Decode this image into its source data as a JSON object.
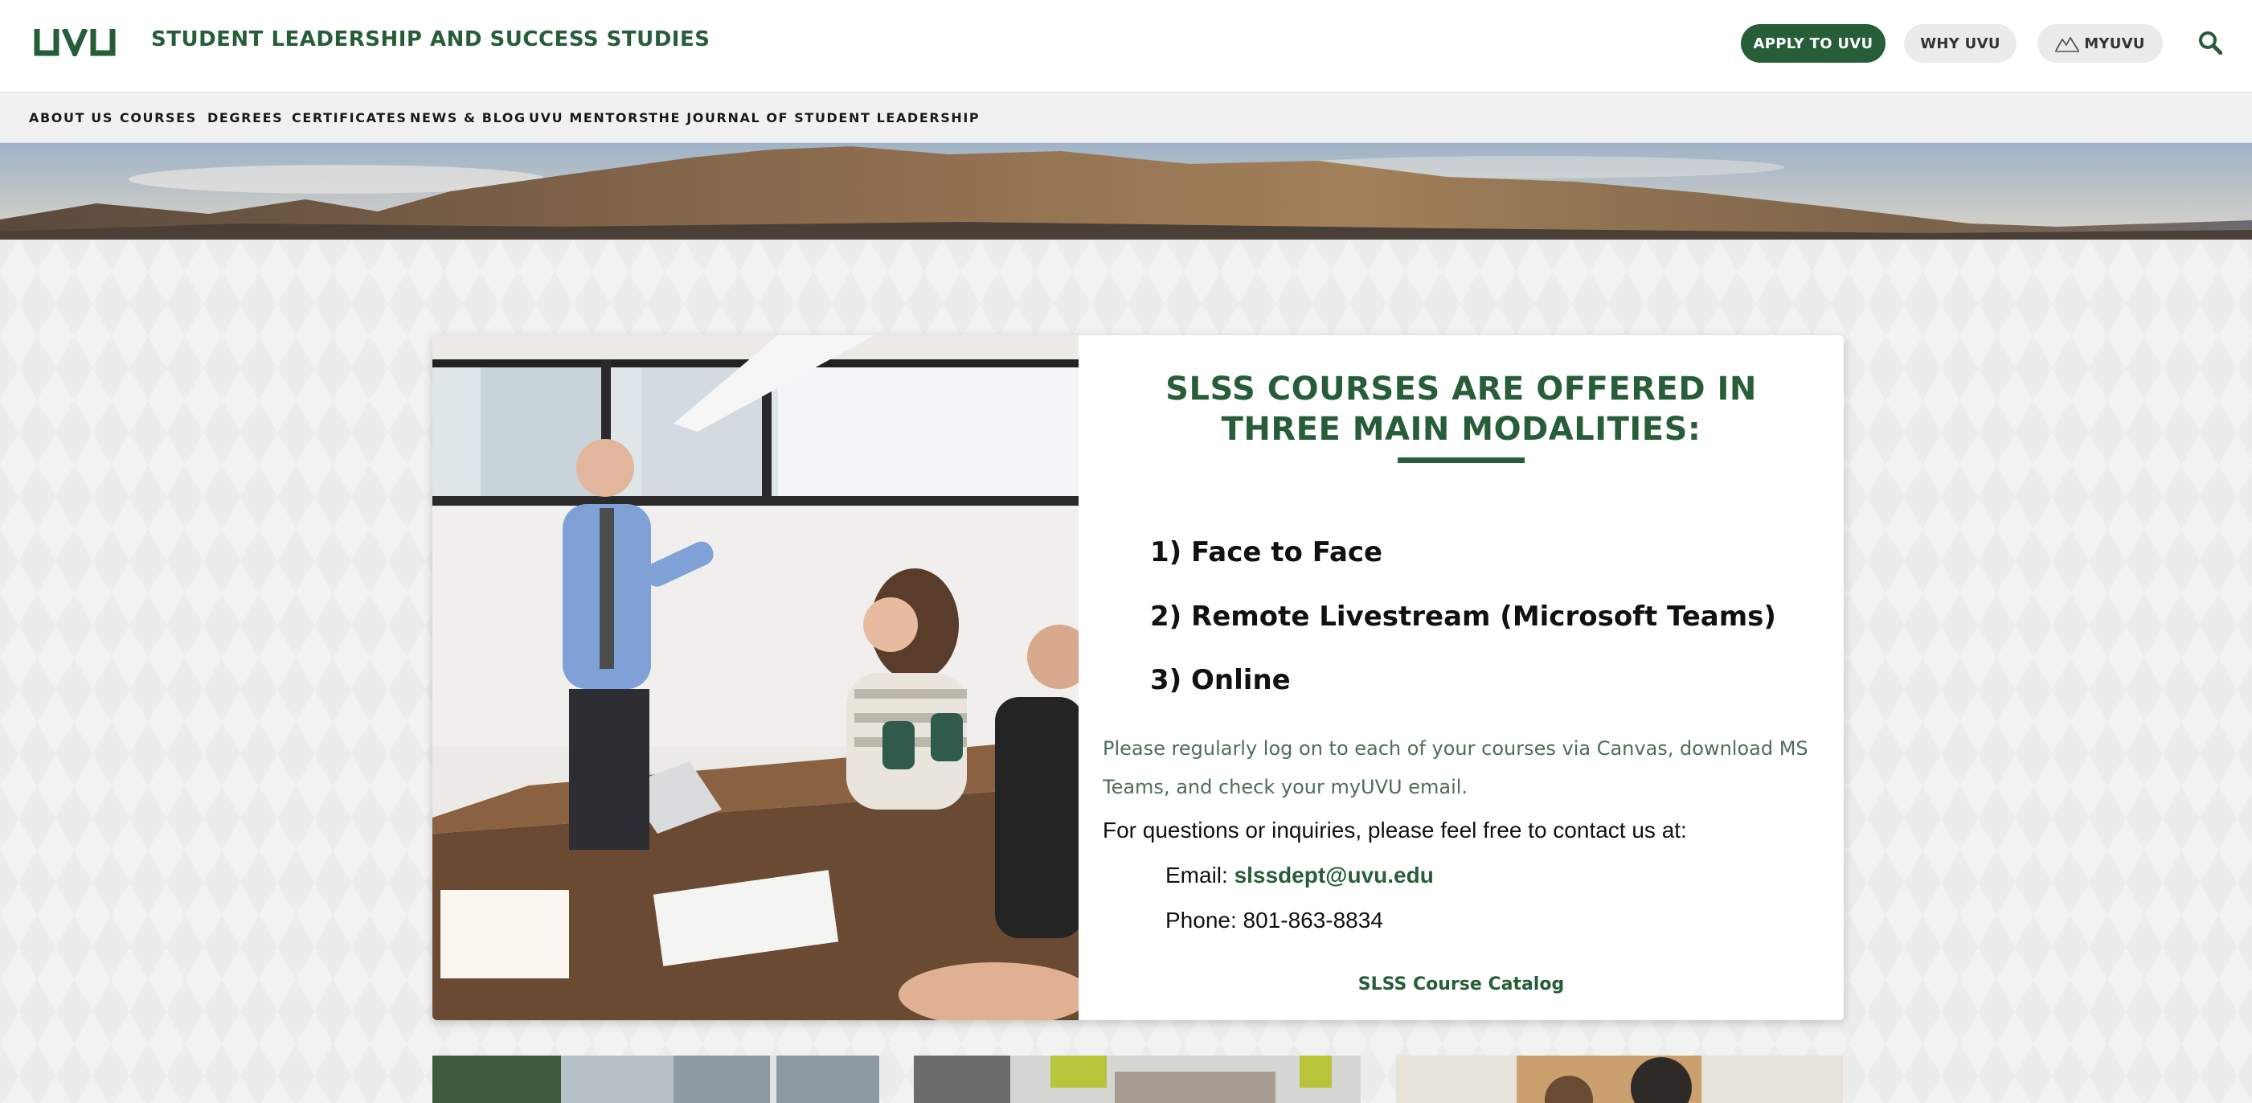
{
  "header": {
    "logo_text": "UVU",
    "site_title": "STUDENT LEADERSHIP AND SUCCESS STUDIES",
    "apply_label": "APPLY TO UVU",
    "why_label": "WHY UVU",
    "myuvu_label": "MYUVU",
    "search_icon": "search-icon",
    "myuvu_icon": "mountain-icon"
  },
  "nav": {
    "items": [
      "ABOUT US",
      "COURSES",
      "DEGREES",
      "CERTIFICATES",
      "NEWS & BLOG",
      "UVU MENTORS",
      "THE JOURNAL OF STUDENT LEADERSHIP"
    ]
  },
  "card": {
    "title": "SLSS COURSES ARE OFFERED IN THREE MAIN MODALITIES:",
    "modalities": [
      "1) Face to Face",
      "2) Remote Livestream (Microsoft Teams)",
      "3) Online"
    ],
    "paragraph": "Please regularly log on to each of your courses via Canvas, download MS Teams, and check your myUVU email.",
    "contact_intro": "For questions or inquiries, please feel free to contact us at:",
    "email_label": "Email: ",
    "email": "slssdept@uvu.edu",
    "phone": "Phone: 801-863-8834",
    "catalog_link": "SLSS Course Catalog"
  },
  "colors": {
    "brand_green": "#275d38",
    "nav_bg": "#f1f1f1",
    "button_grey": "#ebebeb"
  }
}
